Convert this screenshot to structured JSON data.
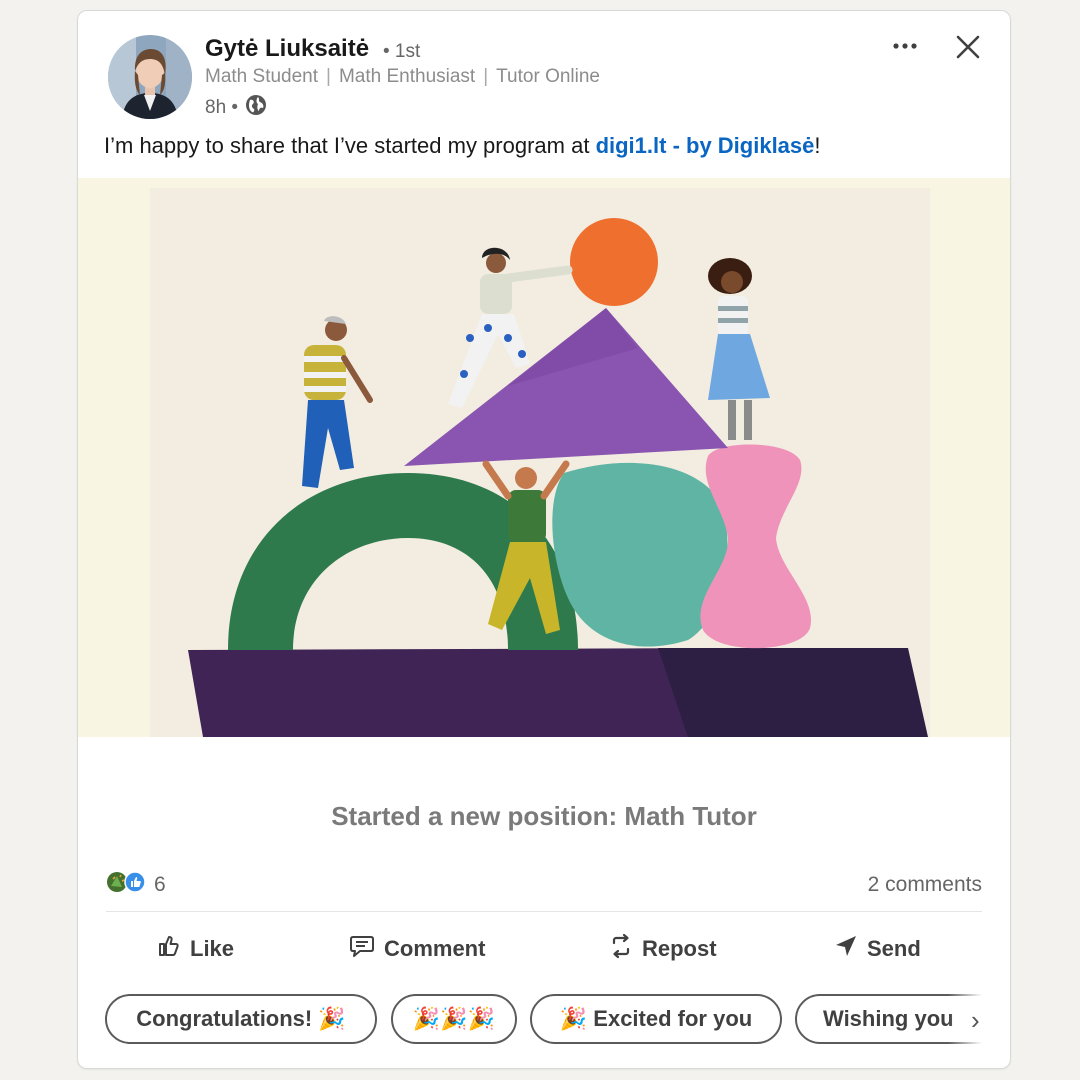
{
  "post": {
    "author_name": "Gytė Liuksaitė",
    "connection_degree": "• 1st",
    "headline_parts": [
      "Math Student",
      "Math Enthusiast",
      "Tutor Online"
    ],
    "headline_separator": "|",
    "time": "8h •",
    "visibility_icon": "globe-icon",
    "text_before": "I’m happy to share that I’ve started my program at ",
    "link_text": "digi1.lt - by Digiklasė",
    "text_after": "!",
    "caption": "Started a new position: Math Tutor"
  },
  "header_actions": {
    "more_icon": "more-dots-icon",
    "close_icon": "close-icon"
  },
  "social": {
    "reaction_icons": [
      "celebrate-icon",
      "like-icon"
    ],
    "reaction_count": "6",
    "comments_count": "2 comments"
  },
  "actions": [
    {
      "label": "Like",
      "icon": "thumbs-up-icon"
    },
    {
      "label": "Comment",
      "icon": "comment-icon"
    },
    {
      "label": "Repost",
      "icon": "repost-icon"
    },
    {
      "label": "Send",
      "icon": "send-icon"
    }
  ],
  "quick_replies": [
    {
      "label": "Congratulations! 🎉"
    },
    {
      "label": "🎉🎉🎉"
    },
    {
      "label": "🎉 Excited for you"
    },
    {
      "label": "Wishing you"
    }
  ],
  "colors": {
    "link": "#0a66c2",
    "accent_blue": "#378fe9",
    "illustration_bg": "#f7f4e1"
  }
}
